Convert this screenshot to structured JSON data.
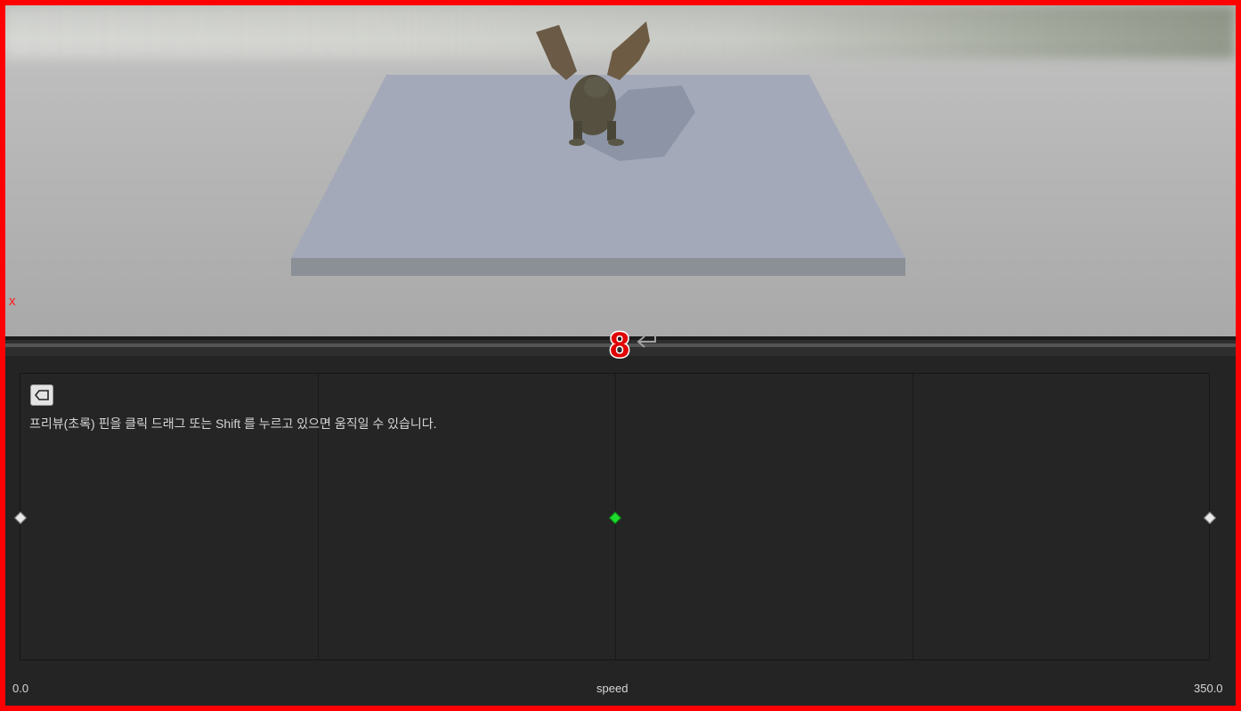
{
  "viewport": {
    "axis_label": "x"
  },
  "step_badge": {
    "number": "8"
  },
  "blend_space": {
    "hint": "프리뷰(초록) 핀을 클릭 드래그 또는 Shift 를 누르고 있으면 움직일 수 있습니다.",
    "x_axis": {
      "name": "speed",
      "min": "0.0",
      "max": "350.0"
    },
    "sample_pins": [
      0,
      350
    ],
    "preview_pin": 175,
    "colors": {
      "sample_pin": "#e8e8e8",
      "preview_pin": "#1edc2e"
    }
  }
}
